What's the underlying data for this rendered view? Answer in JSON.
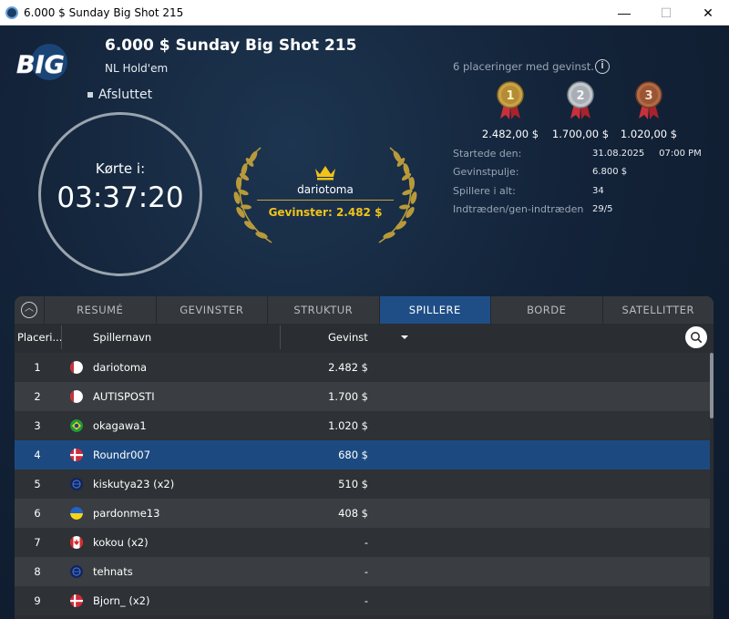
{
  "window": {
    "title": "6.000 $ Sunday Big Shot 215",
    "minimize": "—",
    "maximize": "☐",
    "close": "✕"
  },
  "header": {
    "logo_text": "BIG",
    "title": "6.000 $ Sunday Big Shot 215",
    "game_type": "NL Hold'em",
    "status": "Afsluttet"
  },
  "timer": {
    "label": "Kørte i:",
    "value": "03:37:20"
  },
  "winner": {
    "name": "dariotoma",
    "prize_text": "Gevinster: 2.482 $"
  },
  "prizes": {
    "label": "6 placeringer med gevinst.",
    "info_icon": "info-icon",
    "medals": [
      {
        "rank": "1",
        "amount": "2.482,00 $",
        "color": "#c9a24a"
      },
      {
        "rank": "2",
        "amount": "1.700,00 $",
        "color": "#b9bec4"
      },
      {
        "rank": "3",
        "amount": "1.020,00 $",
        "color": "#b06a45"
      }
    ]
  },
  "details": [
    {
      "label": "Startede den:",
      "value": "31.08.2025     07:00 PM"
    },
    {
      "label": "Gevinstpulje:",
      "value": "6.800 $"
    },
    {
      "label": "Spillere i alt:",
      "value": "34"
    },
    {
      "label": "Indtræden/gen-indtræden",
      "value": "29/5"
    }
  ],
  "tabs": [
    {
      "label": "RESUMÉ",
      "active": false
    },
    {
      "label": "GEVINSTER",
      "active": false
    },
    {
      "label": "STRUKTUR",
      "active": false
    },
    {
      "label": "SPILLERE",
      "active": true
    },
    {
      "label": "BORDE",
      "active": false
    },
    {
      "label": "SATELLITTER",
      "active": false
    }
  ],
  "table": {
    "headers": {
      "place": "Placeri...",
      "name": "Spillernavn",
      "prize": "Gevinst"
    },
    "rows": [
      {
        "place": "1",
        "flag": "blank",
        "name": "dariotoma",
        "prize": "2.482 $",
        "selected": false
      },
      {
        "place": "2",
        "flag": "blank",
        "name": "AUTISPOSTI",
        "prize": "1.700 $",
        "selected": false
      },
      {
        "place": "3",
        "flag": "brazil",
        "name": "okagawa1",
        "prize": "1.020 $",
        "selected": false
      },
      {
        "place": "4",
        "flag": "denmark",
        "name": "Roundr007",
        "prize": "680 $",
        "selected": true
      },
      {
        "place": "5",
        "flag": "globe",
        "name": "kiskutya23 (x2)",
        "prize": "510 $",
        "selected": false
      },
      {
        "place": "6",
        "flag": "ukraine",
        "name": "pardonme13",
        "prize": "408 $",
        "selected": false
      },
      {
        "place": "7",
        "flag": "canada",
        "name": "kokou (x2)",
        "prize": "-",
        "selected": false
      },
      {
        "place": "8",
        "flag": "globe",
        "name": "tehnats",
        "prize": "-",
        "selected": false
      },
      {
        "place": "9",
        "flag": "denmark",
        "name": "Bjorn_ (x2)",
        "prize": "-",
        "selected": false
      }
    ]
  }
}
